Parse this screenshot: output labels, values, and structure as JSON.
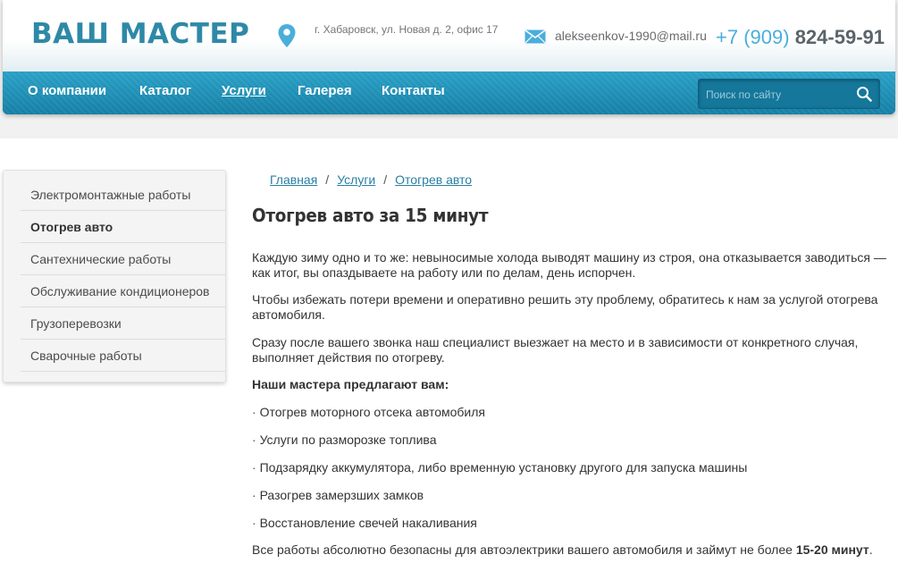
{
  "header": {
    "logo": "ВАШ МАСТЕР",
    "address": "г. Хабаровск, ул. Новая д. 2, офис 17",
    "email": "alekseenkov-1990@mail.ru",
    "phone_code": "+7 (909)",
    "phone_number": "824-59-91",
    "icons": {
      "address": "map-pin-icon",
      "email": "mail-icon"
    },
    "colors": {
      "brand": "#2e89a6",
      "nav": "#1d8fb6",
      "phone_code": "#4aaedb"
    }
  },
  "nav": {
    "items": [
      {
        "label": "О компании"
      },
      {
        "label": "Каталог"
      },
      {
        "label": "Услуги"
      },
      {
        "label": "Галерея"
      },
      {
        "label": "Контакты"
      }
    ],
    "active": "Услуги"
  },
  "search": {
    "placeholder": "Поиск по сайту",
    "value": "",
    "icon": "search-icon"
  },
  "sidebar": {
    "items": [
      {
        "label": "Электромонтажные работы"
      },
      {
        "label": "Отогрев авто"
      },
      {
        "label": "Сантехнические работы"
      },
      {
        "label": "Обслуживание кондиционеров"
      },
      {
        "label": "Грузоперевозки"
      },
      {
        "label": "Сварочные работы"
      }
    ],
    "active": "Отогрев авто"
  },
  "breadcrumb": {
    "items": [
      {
        "label": "Главная"
      },
      {
        "label": "Услуги"
      },
      {
        "label": "Отогрев авто"
      }
    ],
    "separator": "/"
  },
  "article": {
    "title": "Отогрев авто за 15 минут",
    "paragraphs": [
      "Каждую зиму одно и то же: невыносимые холода выводят машину из строя, она отказывается заводиться — как итог, вы опаздываете на работу или по делам, день испорчен.",
      "Чтобы избежать потери времени и оперативно решить эту проблему, обратитесь к нам за услугой отогрева автомобиля.",
      "Сразу после вашего звонка наш специалист выезжает на место и в зависимости от конкретного случая, выполняет действия по отогреву."
    ],
    "offer_heading": "Наши мастера предлагают вам:",
    "offers": [
      "Отогрев моторного отсека автомобиля",
      "Услуги по разморозке топлива",
      "Подзарядку аккумулятора, либо временную установку другого для запуска машины",
      "Разогрев замерзших замков",
      "Восстановление свечей накаливания"
    ],
    "closing_text": "Все работы абсолютно безопасны для автоэлектрики вашего автомобиля и займут не более ",
    "closing_bold": "15-20 минут",
    "closing_end": "."
  }
}
